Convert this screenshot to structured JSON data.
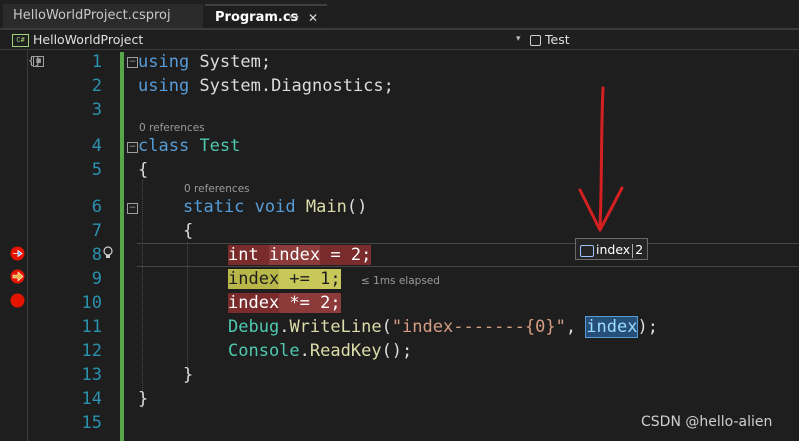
{
  "tabs": [
    {
      "label": "HelloWorldProject.csproj",
      "active": false
    },
    {
      "label": "Program.cs",
      "active": true
    }
  ],
  "nav": {
    "project_icon": "C#",
    "project": "HelloWorldProject",
    "dropdown_glyph": "▾",
    "member": "Test"
  },
  "top_left_glyph": "{}",
  "line_numbers": [
    "1",
    "2",
    "3",
    "4",
    "5",
    "6",
    "7",
    "8",
    "9",
    "10",
    "11",
    "12",
    "13",
    "14",
    "15"
  ],
  "codelens": {
    "class_refs": "0 references",
    "method_refs": "0 references"
  },
  "code": {
    "l1_kw": "using",
    "l1_rest": " System;",
    "l2_kw": "using",
    "l2_rest": " System.Diagnostics;",
    "l4_kw": "class",
    "l4_type": "Test",
    "l5": "{",
    "l6_static": "static",
    "l6_void": "void",
    "l6_fn": "Main",
    "l6_paren": "()",
    "l7": "{",
    "l8_a": "int",
    "l8_b": "index",
    "l8_c": " = 2;",
    "l9_a": "index",
    "l9_b": " += 1;",
    "l10_a": "index",
    "l10_b": " *= 2;",
    "l11_debug": "Debug",
    "l11_dot": ".",
    "l11_fn": "WriteLine",
    "l11_open": "(",
    "l11_str": "\"index-------{0}\"",
    "l11_comma": ", ",
    "l11_var": "index",
    "l11_close": ");",
    "l12_console": "Console",
    "l12_dot": ".",
    "l12_fn": "ReadKey",
    "l12_rest": "();",
    "l13": "}",
    "l14": "}"
  },
  "elapsed": "≤ 1ms elapsed",
  "datatip": {
    "name": "index",
    "value": "2"
  },
  "watermark": "CSDN @hello-alien",
  "colors": {
    "breakpoint": "#e51400",
    "arrow": "#d42020",
    "exec_arrow": "#e8a23a"
  }
}
